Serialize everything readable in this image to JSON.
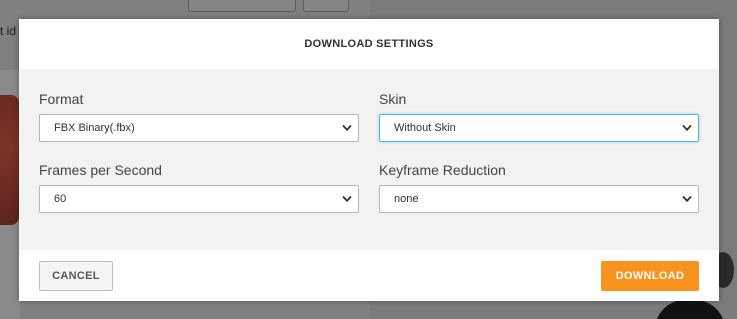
{
  "background": {
    "partial_text": "t id"
  },
  "modal": {
    "title": "DOWNLOAD SETTINGS",
    "fields": {
      "format": {
        "label": "Format",
        "value": "FBX Binary(.fbx)"
      },
      "skin": {
        "label": "Skin",
        "value": "Without Skin"
      },
      "fps": {
        "label": "Frames per Second",
        "value": "60"
      },
      "keyframe": {
        "label": "Keyframe Reduction",
        "value": "none"
      }
    },
    "buttons": {
      "cancel": "CANCEL",
      "download": "DOWNLOAD"
    }
  },
  "colors": {
    "accent": "#f7931e",
    "focus_border": "#57b6d6",
    "body_bg": "#f2f2f2"
  },
  "icons": {
    "select_arrow": "chevron-down-icon"
  }
}
